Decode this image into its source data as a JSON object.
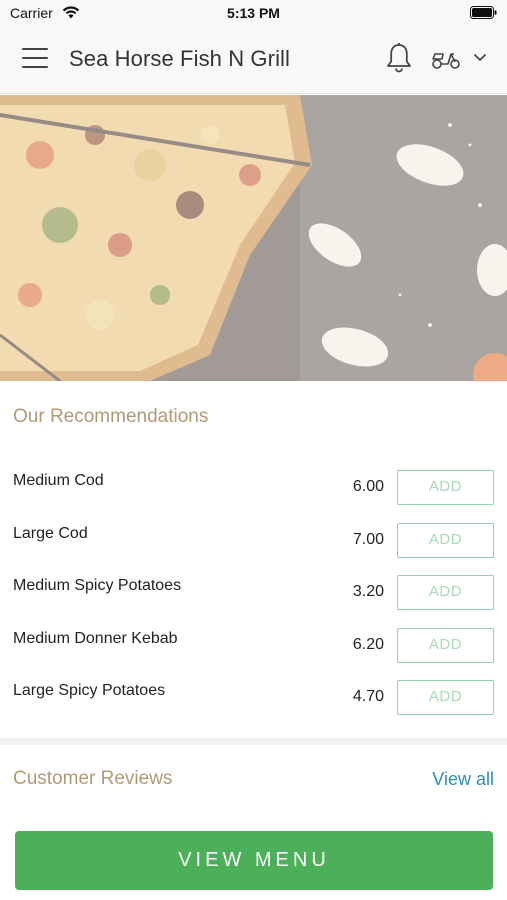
{
  "status_bar": {
    "carrier": "Carrier",
    "time": "5:13 PM",
    "icons": [
      "wifi-icon",
      "battery-icon"
    ]
  },
  "header": {
    "title": "Sea Horse Fish N Grill",
    "icons": [
      "hamburger-menu-icon",
      "bell-icon",
      "scooter-icon",
      "chevron-down-icon"
    ]
  },
  "hero": {
    "image": "pizza-on-wooden-board"
  },
  "recommendations": {
    "title": "Our Recommendations",
    "items": [
      {
        "name": "Medium Cod",
        "price": "6.00",
        "button": "ADD"
      },
      {
        "name": "Large Cod",
        "price": "7.00",
        "button": "ADD"
      },
      {
        "name": "Medium Spicy Potatoes",
        "price": "3.20",
        "button": "ADD"
      },
      {
        "name": "Medium Donner Kebab",
        "price": "6.20",
        "button": "ADD"
      },
      {
        "name": "Large Spicy Potatoes",
        "price": "4.70",
        "button": "ADD"
      }
    ]
  },
  "reviews": {
    "title": "Customer Reviews",
    "view_all": "View all"
  },
  "cta": {
    "label": "VIEW MENU"
  },
  "colors": {
    "accent_gold": "#b09a76",
    "primary_green": "#4caf59",
    "add_border": "#8fd4a9",
    "link_blue": "#2b8fb8"
  }
}
